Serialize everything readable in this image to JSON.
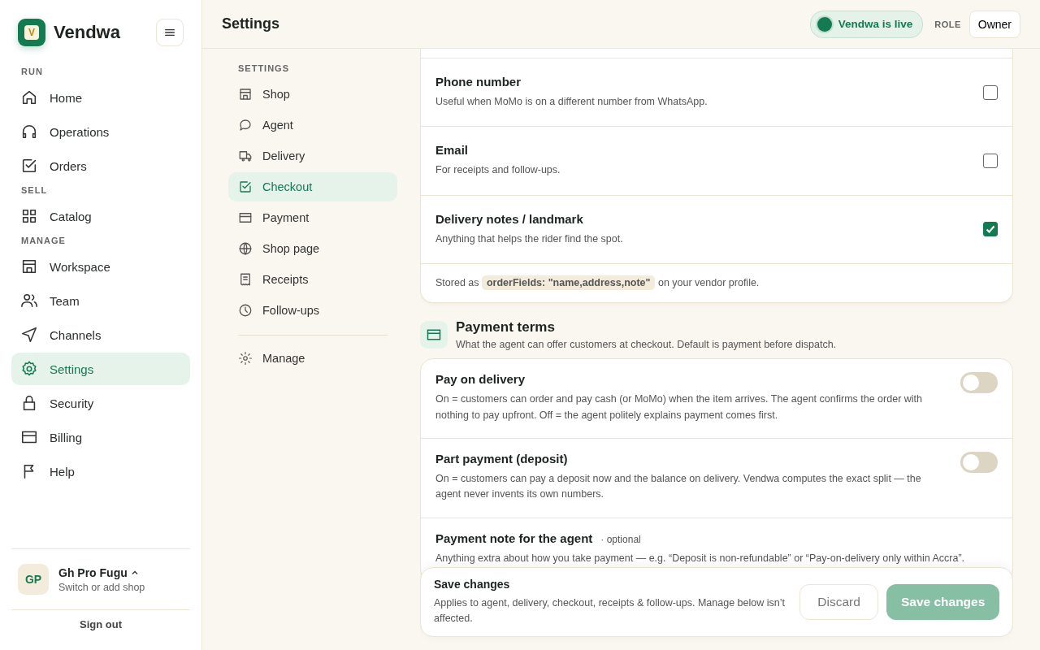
{
  "brand": {
    "logo_letter": "V",
    "name": "Vendwa"
  },
  "sidebar": {
    "sections": [
      {
        "label": "RUN",
        "items": [
          {
            "label": "Home",
            "selected": false
          },
          {
            "label": "Operations",
            "selected": false
          },
          {
            "label": "Orders",
            "selected": false
          }
        ]
      },
      {
        "label": "SELL",
        "items": [
          {
            "label": "Catalog",
            "selected": false
          }
        ]
      },
      {
        "label": "MANAGE",
        "items": [
          {
            "label": "Workspace",
            "selected": false
          },
          {
            "label": "Team",
            "selected": false
          },
          {
            "label": "Channels",
            "selected": false
          },
          {
            "label": "Settings",
            "selected": true
          },
          {
            "label": "Security",
            "selected": false
          },
          {
            "label": "Billing",
            "selected": false
          },
          {
            "label": "Help",
            "selected": false
          }
        ]
      }
    ]
  },
  "account": {
    "initials": "GP",
    "name": "Gh Pro Fugu",
    "subtitle": "Switch or add shop",
    "sign_out": "Sign out"
  },
  "header": {
    "title": "Settings",
    "status": "Vendwa is live",
    "role_label": "ROLE",
    "role": "Owner"
  },
  "settings_nav": {
    "heading": "SETTINGS",
    "items": [
      {
        "label": "Shop",
        "selected": false
      },
      {
        "label": "Agent",
        "selected": false
      },
      {
        "label": "Delivery",
        "selected": false
      },
      {
        "label": "Checkout",
        "selected": true
      },
      {
        "label": "Payment",
        "selected": false
      },
      {
        "label": "Shop page",
        "selected": false
      },
      {
        "label": "Receipts",
        "selected": false
      },
      {
        "label": "Follow-ups",
        "selected": false
      }
    ],
    "footer_item": "Manage"
  },
  "checkout_fields": {
    "rows": [
      {
        "title": "Phone number",
        "description": "Useful when MoMo is on a different number from WhatsApp.",
        "checked": false
      },
      {
        "title": "Email",
        "description": "For receipts and follow-ups.",
        "checked": false
      },
      {
        "title": "Delivery notes / landmark",
        "description": "Anything that helps the rider find the spot.",
        "checked": true
      }
    ],
    "note_prefix": "Stored as",
    "note_code": "orderFields: \"name,address,note\"",
    "note_suffix": "on your vendor profile."
  },
  "payment_terms": {
    "title": "Payment terms",
    "description": "What the agent can offer customers at checkout. Default is payment before dispatch.",
    "rows": [
      {
        "kind": "toggle",
        "title": "Pay on delivery",
        "description": "On = customers can order and pay cash (or MoMo) when the item arrives. The agent confirms the order with nothing to pay upfront. Off = the agent politely explains payment comes first.",
        "on": false
      },
      {
        "kind": "toggle",
        "title": "Part payment (deposit)",
        "description": "On = customers can pay a deposit now and the balance on delivery. Vendwa computes the exact split — the agent never invents its own numbers.",
        "on": false
      },
      {
        "kind": "note",
        "title": "Payment note for the agent",
        "tag": "· optional",
        "description": "Anything extra about how you take payment — e.g. “Deposit is non-refundable” or “Pay-on-delivery only within Accra”."
      }
    ]
  },
  "save_bar": {
    "title": "Save changes",
    "description": "Applies to agent, delivery, checkout, receipts & follow-ups. Manage below isn’t affected.",
    "discard": "Discard",
    "save": "Save changes",
    "save_disabled": true
  }
}
